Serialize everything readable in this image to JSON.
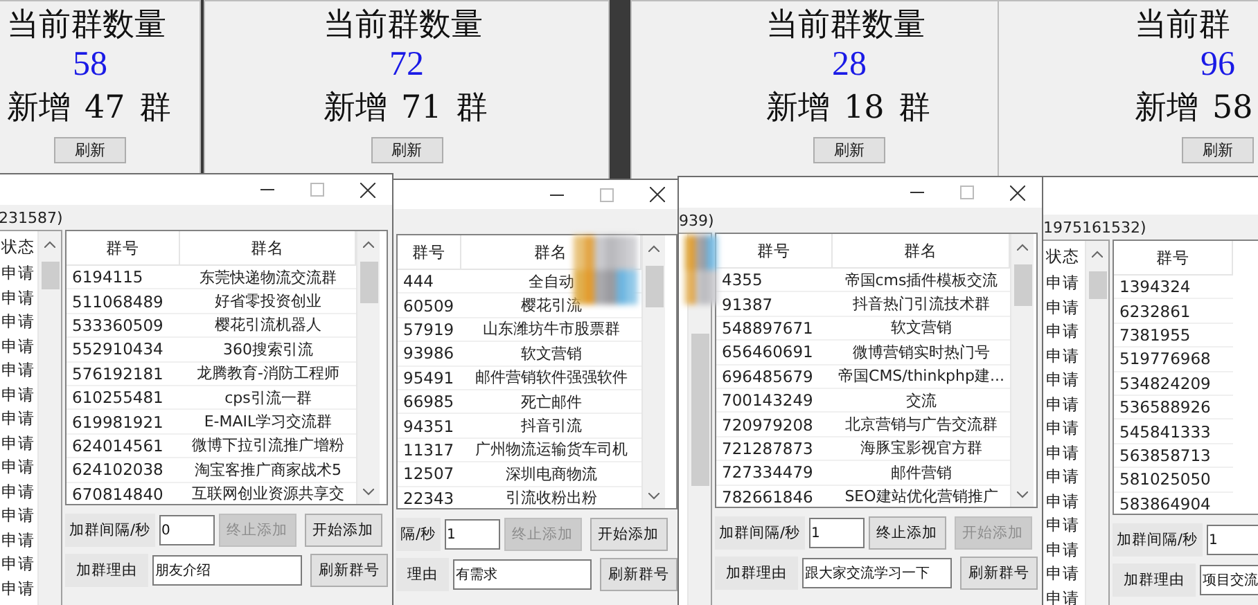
{
  "stat_windows": [
    {
      "title": "当前群数量",
      "count": "58",
      "new_prefix": "新增",
      "new_count": "47",
      "new_suffix": "群",
      "button": "刷新"
    },
    {
      "title": "当前群数量",
      "count": "72",
      "new_prefix": "新增",
      "new_count": "71",
      "new_suffix": "群",
      "button": "刷新"
    },
    {
      "title": "当前群数量",
      "count": "28",
      "new_prefix": "新增",
      "new_count": "18",
      "new_suffix": "群",
      "button": "刷新"
    },
    {
      "title": "当前群",
      "count": "96",
      "new_prefix": "新增",
      "new_count": "58",
      "button": "刷新"
    }
  ],
  "add_windows": [
    {
      "caption_buttons": true,
      "subtitle": "231587)",
      "status_list": {
        "header": "状态",
        "items": [
          "申请",
          "申请",
          "申请",
          "申请",
          "申请",
          "申请",
          "申请",
          "申请",
          "申请",
          "申请",
          "申请",
          "申请",
          "申请",
          "申请"
        ]
      },
      "table": {
        "columns": [
          "群号",
          "群名"
        ],
        "rows": [
          {
            "id": "6194115",
            "name": "东莞快递物流交流群"
          },
          {
            "id": "511068489",
            "name": "好省零投资创业"
          },
          {
            "id": "533360509",
            "name": "樱花引流机器人"
          },
          {
            "id": "552910434",
            "name": "360搜索引流"
          },
          {
            "id": "576192181",
            "name": "龙腾教育-消防工程师"
          },
          {
            "id": "610255481",
            "name": "cps引流一群"
          },
          {
            "id": "619981921",
            "name": "E-MAIL学习交流群"
          },
          {
            "id": "624014561",
            "name": "微博下拉引流推广增粉"
          },
          {
            "id": "624102038",
            "name": "淘宝客推广商家战术5"
          },
          {
            "id": "670814840",
            "name": "互联网创业资源共享交"
          }
        ]
      },
      "interval_label": "加群间隔/秒",
      "interval": "0",
      "stop_button": {
        "label": "终止添加",
        "disabled": true
      },
      "start_button": {
        "label": "开始添加",
        "disabled": false
      },
      "reason_label": "加群理由",
      "reason": "朋友介绍",
      "refresh_button": "刷新群号"
    },
    {
      "caption_buttons": true,
      "table": {
        "columns": [
          "群号",
          "群名"
        ],
        "rows": [
          {
            "id": "444",
            "name": "全自动"
          },
          {
            "id": "60509",
            "name": "樱花引流"
          },
          {
            "id": "57919",
            "name": "山东潍坊牛市股票群"
          },
          {
            "id": "93986",
            "name": "软文营销"
          },
          {
            "id": "95491",
            "name": "邮件营销软件强强软件"
          },
          {
            "id": "66985",
            "name": "死亡邮件"
          },
          {
            "id": "94351",
            "name": "抖音引流"
          },
          {
            "id": "11317",
            "name": "广州物流运输货车司机"
          },
          {
            "id": "12507",
            "name": "深圳电商物流"
          },
          {
            "id": "22343",
            "name": "引流收粉出粉"
          }
        ]
      },
      "interval_label": "隔/秒",
      "interval": "1",
      "stop_button": {
        "label": "终止添加",
        "disabled": true
      },
      "start_button": {
        "label": "开始添加",
        "disabled": false
      },
      "reason_label": "理由",
      "reason": "有需求",
      "refresh_button": "刷新群号"
    },
    {
      "caption_buttons": true,
      "subtitle": "939)",
      "table": {
        "columns": [
          "群号",
          "群名"
        ],
        "rows": [
          {
            "id": "4355",
            "name": "帝国cms插件模板交流"
          },
          {
            "id": "91387",
            "name": "抖音热门引流技术群"
          },
          {
            "id": "548897671",
            "name": "软文营销"
          },
          {
            "id": "656460691",
            "name": "微博营销实时热门号"
          },
          {
            "id": "696485679",
            "name": "帝国CMS/thinkphp建..."
          },
          {
            "id": "700143249",
            "name": "交流"
          },
          {
            "id": "720979208",
            "name": "北京营销与广告交流群"
          },
          {
            "id": "721287873",
            "name": "海豚宝影视官方群"
          },
          {
            "id": "727334479",
            "name": "邮件营销"
          },
          {
            "id": "782661846",
            "name": "SEO建站优化营销推广"
          }
        ]
      },
      "interval_label": "加群间隔/秒",
      "interval": "1",
      "stop_button": {
        "label": "终止添加",
        "disabled": false
      },
      "start_button": {
        "label": "开始添加",
        "disabled": true
      },
      "reason_label": "加群理由",
      "reason": "跟大家交流学习一下",
      "refresh_button": "刷新群号"
    },
    {
      "caption_buttons": false,
      "subtitle": "1975161532)",
      "status_list": {
        "header": "状态",
        "items": [
          "申请",
          "申请",
          "申请",
          "申请",
          "申请",
          "申请",
          "申请",
          "申请",
          "申请",
          "申请",
          "申请",
          "申请",
          "申请",
          "申请"
        ]
      },
      "table": {
        "columns": [
          "群号"
        ],
        "rows": [
          {
            "id": "1394324"
          },
          {
            "id": "6232861"
          },
          {
            "id": "7381955"
          },
          {
            "id": "519776968"
          },
          {
            "id": "534824209"
          },
          {
            "id": "536588926"
          },
          {
            "id": "545841333"
          },
          {
            "id": "563858713"
          },
          {
            "id": "581025050"
          },
          {
            "id": "583864904"
          }
        ]
      },
      "interval_label": "加群间隔/秒",
      "interval": "1",
      "reason_label": "加群理由",
      "reason": "项目交流"
    }
  ]
}
